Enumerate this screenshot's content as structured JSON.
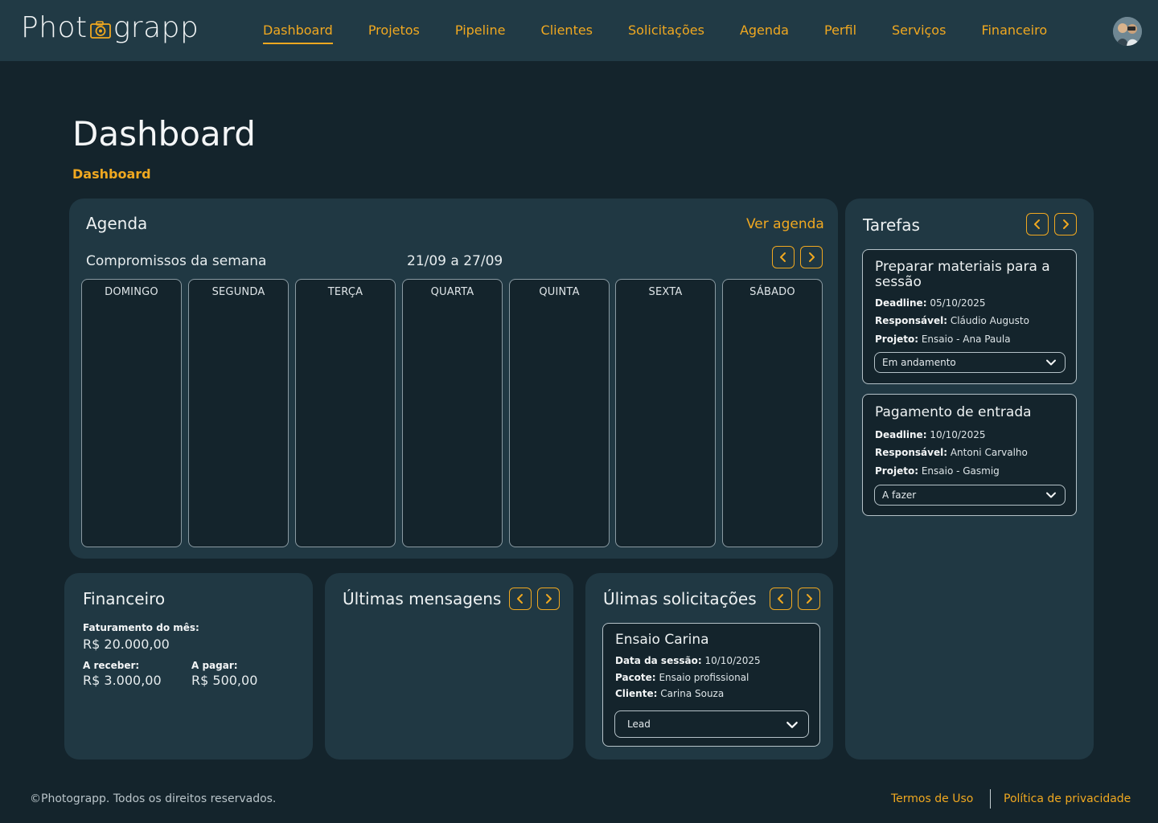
{
  "brand": {
    "name_left": "Phot",
    "name_right": "grapp"
  },
  "nav": {
    "items": [
      {
        "label": "Dashboard",
        "active": true
      },
      {
        "label": "Projetos"
      },
      {
        "label": "Pipeline"
      },
      {
        "label": "Clientes"
      },
      {
        "label": "Solicitações"
      },
      {
        "label": "Agenda"
      },
      {
        "label": "Perfil"
      },
      {
        "label": "Serviços"
      },
      {
        "label": "Financeiro"
      }
    ]
  },
  "page": {
    "title": "Dashboard",
    "breadcrumb": "Dashboard"
  },
  "agenda": {
    "title": "Agenda",
    "link": "Ver agenda",
    "subtitle": "Compromissos da semana",
    "range": "21/09 a 27/09",
    "days": [
      "DOMINGO",
      "SEGUNDA",
      "TERÇA",
      "QUARTA",
      "QUINTA",
      "SEXTA",
      "SÁBADO"
    ]
  },
  "tasks": {
    "title": "Tarefas",
    "items": [
      {
        "title": "Preparar materiais para a sessão",
        "deadline_label": "Deadline:",
        "deadline": "05/10/2025",
        "owner_label": "Responsável:",
        "owner": "Cláudio Augusto",
        "project_label": "Projeto:",
        "project": "Ensaio - Ana Paula",
        "status": "Em andamento"
      },
      {
        "title": "Pagamento de entrada",
        "deadline_label": "Deadline:",
        "deadline": "10/10/2025",
        "owner_label": "Responsável:",
        "owner": "Antoni Carvalho",
        "project_label": "Projeto:",
        "project": "Ensaio - Gasmig",
        "status": "A fazer"
      }
    ]
  },
  "finance": {
    "title": "Financeiro",
    "revenue_label": "Faturamento do mês:",
    "revenue": "R$ 20.000,00",
    "receivable_label": "A receber:",
    "receivable": "R$ 3.000,00",
    "payable_label": "A pagar:",
    "payable": "R$ 500,00"
  },
  "messages": {
    "title": "Últimas mensagens"
  },
  "requests": {
    "title": "Úlimas solicitações",
    "item": {
      "title": "Ensaio Carina",
      "date_label": "Data da sessão:",
      "date": "10/10/2025",
      "package_label": "Pacote:",
      "package": "Ensaio profissional",
      "client_label": "Cliente:",
      "client": "Carina Souza",
      "status": "Lead"
    }
  },
  "footer": {
    "copyright": "©Photograpp. Todos os direitos reservados.",
    "terms": "Termos de Uso",
    "privacy": "Política de privacidade"
  },
  "colors": {
    "accent": "#f0a820",
    "background": "#14242c",
    "card": "#203843",
    "header": "#213a45"
  },
  "icons": [
    "camera-icon",
    "chevron-left-icon",
    "chevron-right-icon",
    "chevron-down-icon",
    "user-avatar"
  ]
}
